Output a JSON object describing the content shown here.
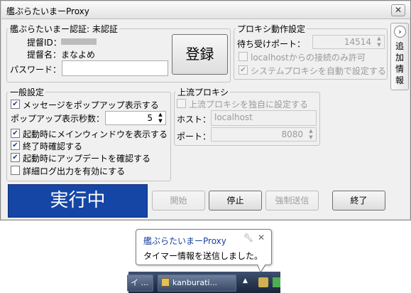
{
  "window": {
    "title": "艦ぶらたいまーProxy",
    "close_glyph": "✕"
  },
  "auth": {
    "legend": "艦ぶらたいまー認証: 未認証",
    "admiral_id_label": "提督ID：",
    "admiral_name_label": "提督名：",
    "admiral_name_value": "まなよめ",
    "password_label": "パスワード：",
    "password_value": "",
    "register_button": "登録"
  },
  "proxy": {
    "legend": "プロキシ動作設定",
    "port_label": "待ち受けポート：",
    "port_value": "14514",
    "localhost_only_label": "localhostからの接続のみ許可",
    "localhost_only_checked": false,
    "system_proxy_label": "システムプロキシを自動で設定する",
    "system_proxy_checked": true
  },
  "general": {
    "legend": "一般設定",
    "popup_label": "メッセージをポップアップ表示する",
    "popup_checked": true,
    "popup_seconds_label": "ポップアップ表示秒数：",
    "popup_seconds_value": "5",
    "main_window_label": "起動時にメインウィンドウを表示する",
    "main_window_checked": true,
    "confirm_exit_label": "終了時確認する",
    "confirm_exit_checked": true,
    "check_update_label": "起動時にアップデートを確認する",
    "check_update_checked": true,
    "verbose_log_label": "詳細ログ出力を有効にする",
    "verbose_log_checked": false
  },
  "upstream": {
    "legend": "上流プロキシ",
    "enable_label": "上流プロキシを独自に設定する",
    "enable_checked": false,
    "host_label": "ホスト：",
    "host_value": "localhost",
    "port_label": "ポート：",
    "port_value": "8080"
  },
  "status": {
    "text": "実行中",
    "color": "#1546a6"
  },
  "buttons": {
    "start": "開始",
    "stop": "停止",
    "force_send": "強制送信",
    "exit": "終了"
  },
  "side": {
    "arrow": "›",
    "label": "追加情報"
  },
  "notification": {
    "title": "艦ぶらたいまーProxy",
    "message": "タイマー情報を送信しました。"
  },
  "taskbar": {
    "item1": "イ ...",
    "item2": "kanburati..."
  }
}
